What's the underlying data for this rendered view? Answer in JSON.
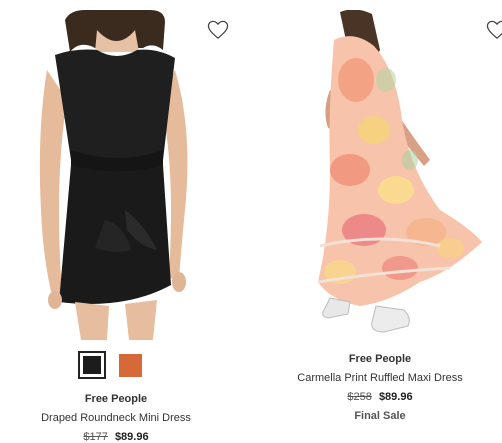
{
  "products": [
    {
      "brand": "Free People",
      "name": "Draped Roundneck Mini Dress",
      "original_price": "$177",
      "sale_price": "$89.96",
      "image_alt": "black mini dress",
      "swatches": [
        {
          "color": "#1c1c1c",
          "selected": true
        },
        {
          "color": "#d7683a",
          "selected": false
        }
      ]
    },
    {
      "brand": "Free People",
      "name": "Carmella Print Ruffled Maxi Dress",
      "original_price": "$258",
      "sale_price": "$89.96",
      "sale_label": "Final Sale",
      "image_alt": "floral ruffled maxi dress"
    }
  ],
  "icons": {
    "favorite": "heart-outline-icon"
  },
  "colors": {
    "text": "#333333",
    "price": "#222222",
    "swatch_selected_border": "#222222"
  }
}
